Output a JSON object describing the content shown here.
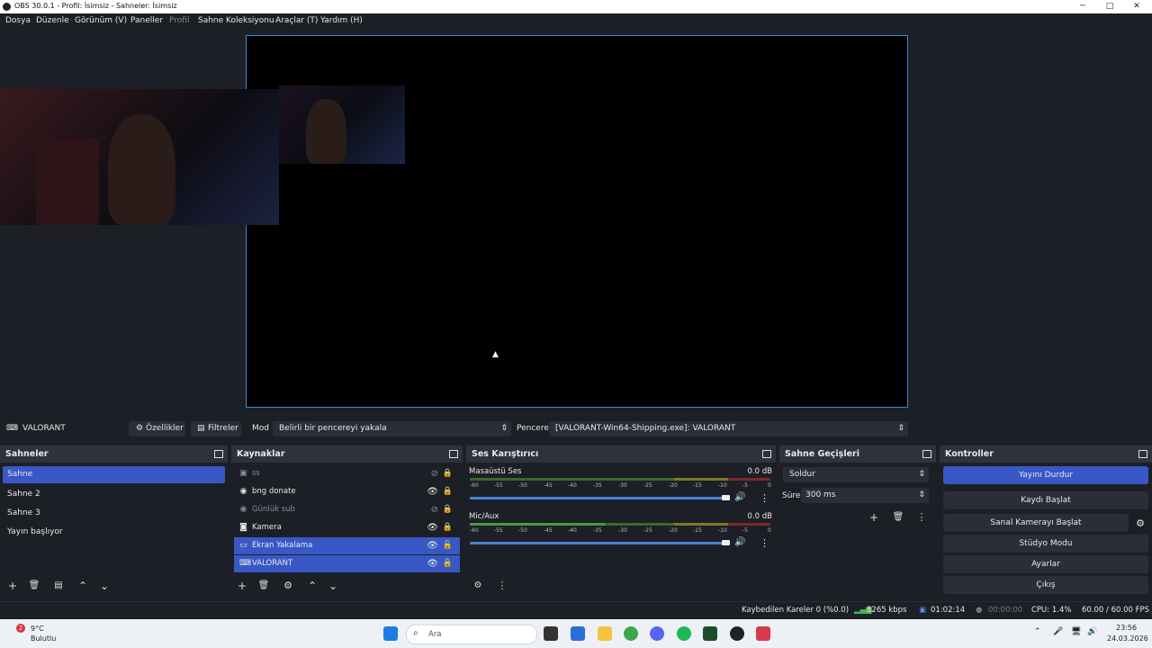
{
  "titlebar": {
    "title": "OBS 30.0.1 - Profil: İsimsiz - Sahneler: İsimsiz",
    "minimize": "─",
    "maximize": "□",
    "close": "✕"
  },
  "menu": [
    "Dosya",
    "Düzenle",
    "Görünüm (V)",
    "Paneller",
    "Profil",
    "Sahne Koleksiyonu",
    "Araçlar (T)",
    "Yardım (H)"
  ],
  "source_bar": {
    "source_name": "VALORANT",
    "properties": "Özellikler",
    "filters": "Filtreler",
    "mode_label": "Mod",
    "mode_value": "Belirli bir pencereyi yakala",
    "window_label": "Pencere",
    "window_value": "[VALORANT-Win64-Shipping.exe]: VALORANT"
  },
  "scenes": {
    "title": "Sahneler",
    "items": [
      "Sahne",
      "Sahne 2",
      "Sahne 3",
      "Yayın başlıyor"
    ]
  },
  "sources": {
    "title": "Kaynaklar",
    "items": [
      {
        "label": "ss",
        "icon": "image-icon",
        "visible": false
      },
      {
        "label": "bng donate",
        "icon": "browser-icon",
        "visible": true
      },
      {
        "label": "Günlük sub",
        "icon": "browser-icon",
        "visible": false
      },
      {
        "label": "Kamera",
        "icon": "camera-icon",
        "visible": true
      },
      {
        "label": "Ekran Yakalama",
        "icon": "monitor-icon",
        "visible": true
      },
      {
        "label": "VALORANT",
        "icon": "gamepad-icon",
        "visible": true
      }
    ]
  },
  "mixer": {
    "title": "Ses Karıştırıcı",
    "channels": [
      {
        "name": "Masaüstü Ses",
        "db": "0.0 dB"
      },
      {
        "name": "Mic/Aux",
        "db": "0.0 dB"
      }
    ],
    "ticks": [
      "-60",
      "-55",
      "-50",
      "-45",
      "-40",
      "-35",
      "-30",
      "-25",
      "-20",
      "-15",
      "-10",
      "-5",
      "0"
    ]
  },
  "transitions": {
    "title": "Sahne Geçişleri",
    "transition": "Soldur",
    "duration_label": "Süre",
    "duration_value": "300 ms"
  },
  "controls": {
    "title": "Kontroller",
    "stop_stream": "Yayını Durdur",
    "start_record": "Kaydı Başlat",
    "virtual_cam": "Sanal Kamerayı Başlat",
    "studio": "Stüdyo Modu",
    "settings": "Ayarlar",
    "exit": "Çıkış"
  },
  "status": {
    "dropped": "Kaybedilen Kareler 0 (%0.0)",
    "bitrate": "8265 kbps",
    "stream_time": "01:02:14",
    "record_time": "00:00:00",
    "cpu": "CPU: 1.4%",
    "fps": "60.00 / 60.00 FPS"
  },
  "taskbar": {
    "weather_temp": "9°C",
    "weather_desc": "Bulutlu",
    "weather_badge": "2",
    "search": "Ara",
    "time": "23:56",
    "date": "24.03.2026"
  }
}
